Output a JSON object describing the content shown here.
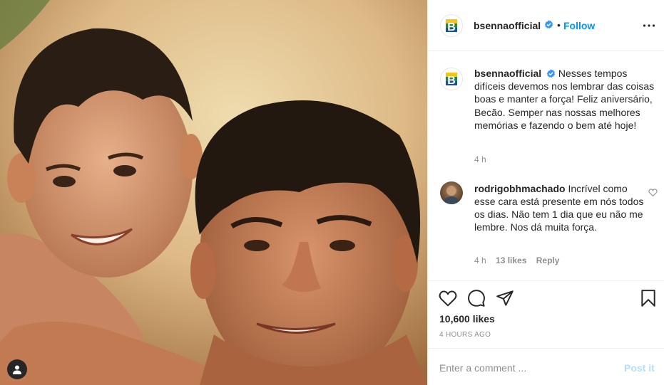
{
  "post": {
    "username": "bsennaofficial",
    "follow_label": "Follow",
    "separator": "•",
    "caption": "Nesses tempos difíceis devemos nos lembrar das coisas boas e manter a força! Feliz aniversário, Becão. Semper nas nossas melhores memórias e fazendo o bem até hoje!",
    "caption_time": "4 h",
    "likes": "10,600 likes",
    "time_ago": "4 HOURS AGO",
    "brand_letter": "B"
  },
  "comment": {
    "username": "rodrigobhmachado",
    "text": "Incrível como esse cara está presente em nós todos os dias. Não tem 1 dia que eu não me lembre. Nos dá muita força.",
    "time": "4 h",
    "likes": "13 likes",
    "reply_label": "Reply"
  },
  "comment_box": {
    "placeholder": "Enter a comment ...",
    "post_label": "Post it"
  },
  "colors": {
    "link_blue": "#0095f6",
    "post_disabled": "#b2dffc",
    "verified_blue": "#3897f0",
    "brand_green": "#1e8a3a",
    "brand_yellow": "#f6c318",
    "brand_blue": "#1a4f9c"
  },
  "icons": [
    "verified-badge-icon",
    "more-options-icon",
    "heart-icon",
    "comment-icon",
    "share-icon",
    "bookmark-icon",
    "user-tag-icon"
  ]
}
